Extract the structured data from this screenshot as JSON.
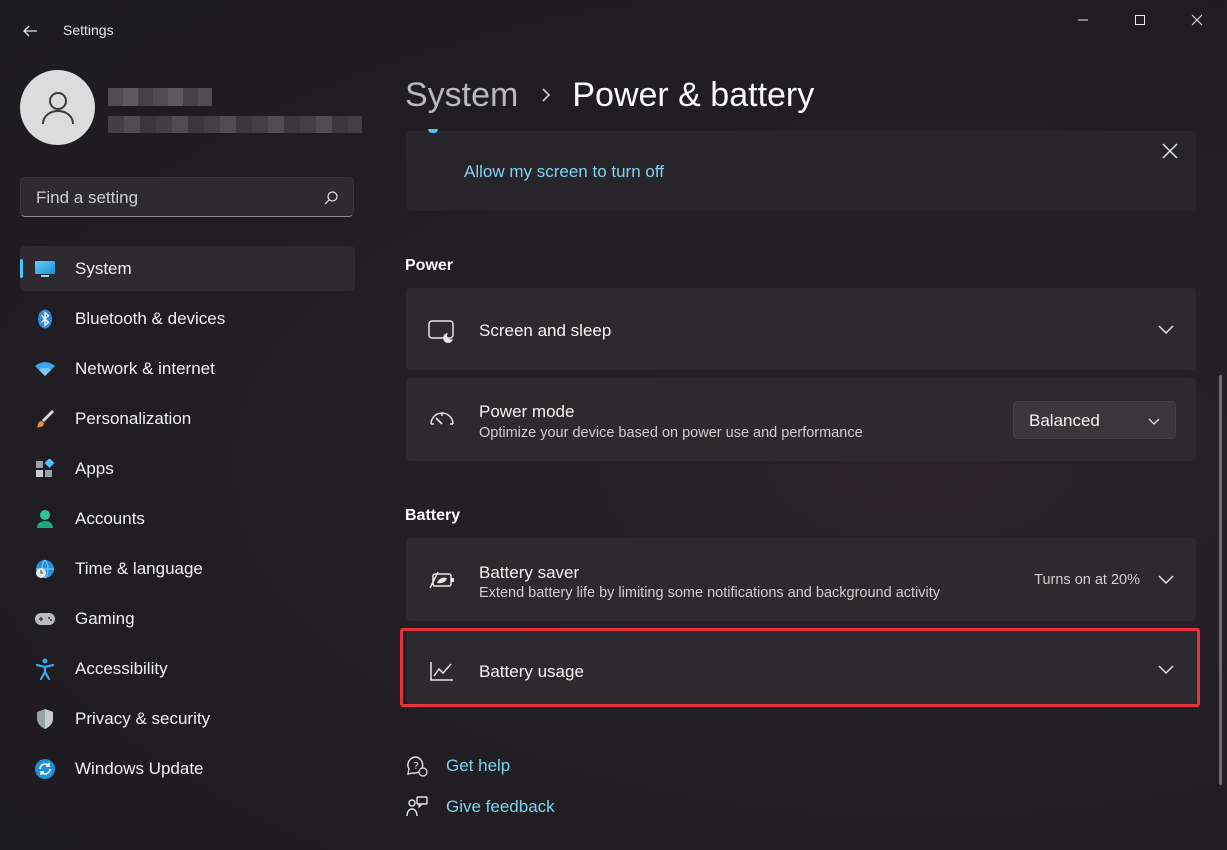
{
  "app": {
    "title": "Settings"
  },
  "search": {
    "placeholder": "Find a setting"
  },
  "sidebar": {
    "items": [
      {
        "label": "System",
        "icon": "system-icon",
        "active": true
      },
      {
        "label": "Bluetooth & devices",
        "icon": "bluetooth-icon"
      },
      {
        "label": "Network & internet",
        "icon": "wifi-icon"
      },
      {
        "label": "Personalization",
        "icon": "brush-icon"
      },
      {
        "label": "Apps",
        "icon": "apps-icon"
      },
      {
        "label": "Accounts",
        "icon": "accounts-icon"
      },
      {
        "label": "Time & language",
        "icon": "globe-clock-icon"
      },
      {
        "label": "Gaming",
        "icon": "gamepad-icon"
      },
      {
        "label": "Accessibility",
        "icon": "accessibility-icon"
      },
      {
        "label": "Privacy & security",
        "icon": "shield-icon"
      },
      {
        "label": "Windows Update",
        "icon": "update-icon"
      }
    ]
  },
  "breadcrumb": {
    "parent": "System",
    "current": "Power & battery"
  },
  "recommendation": {
    "link": "Allow my screen to turn off"
  },
  "power": {
    "header": "Power",
    "screen_sleep": {
      "title": "Screen and sleep"
    },
    "power_mode": {
      "title": "Power mode",
      "subtitle": "Optimize your device based on power use and performance",
      "selected": "Balanced"
    }
  },
  "battery": {
    "header": "Battery",
    "saver": {
      "title": "Battery saver",
      "subtitle": "Extend battery life by limiting some notifications and background activity",
      "value": "Turns on at 20%"
    },
    "usage": {
      "title": "Battery usage"
    }
  },
  "help": {
    "get_help": "Get help",
    "give_feedback": "Give feedback"
  },
  "colors": {
    "accent": "#4cc2ff",
    "link": "#7ed3ef",
    "highlight": "#e5333c"
  }
}
